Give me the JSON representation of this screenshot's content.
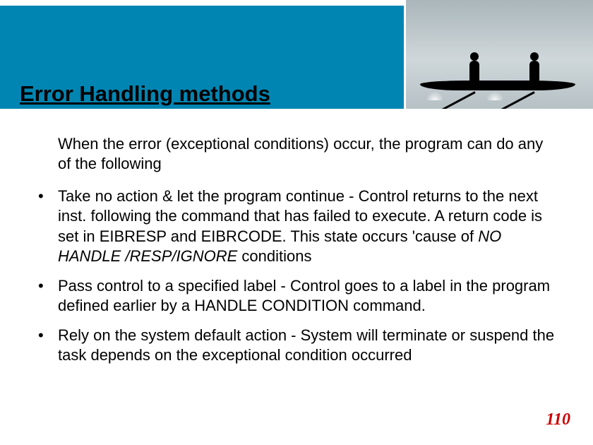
{
  "title": "Error Handling methods",
  "intro": "When the error (exceptional conditions) occur, the program can do any of the following",
  "bullets": [
    {
      "pre": "Take no action & let the program continue - Control returns to the next inst. following the  command that has failed to execute. A return code  is set in EIBRESP and EIBRCODE. This state occurs 'cause of  ",
      "em": "NO HANDLE /RESP/IGNORE ",
      "post": " conditions"
    },
    {
      "pre": "Pass control to a specified label - Control goes to a label in the program defined earlier by a HANDLE CONDITION command.",
      "em": "",
      "post": ""
    },
    {
      "pre": "Rely on the system default action - System will terminate or suspend the task depends on the exceptional condition occurred",
      "em": "",
      "post": ""
    }
  ],
  "page_number": "110"
}
